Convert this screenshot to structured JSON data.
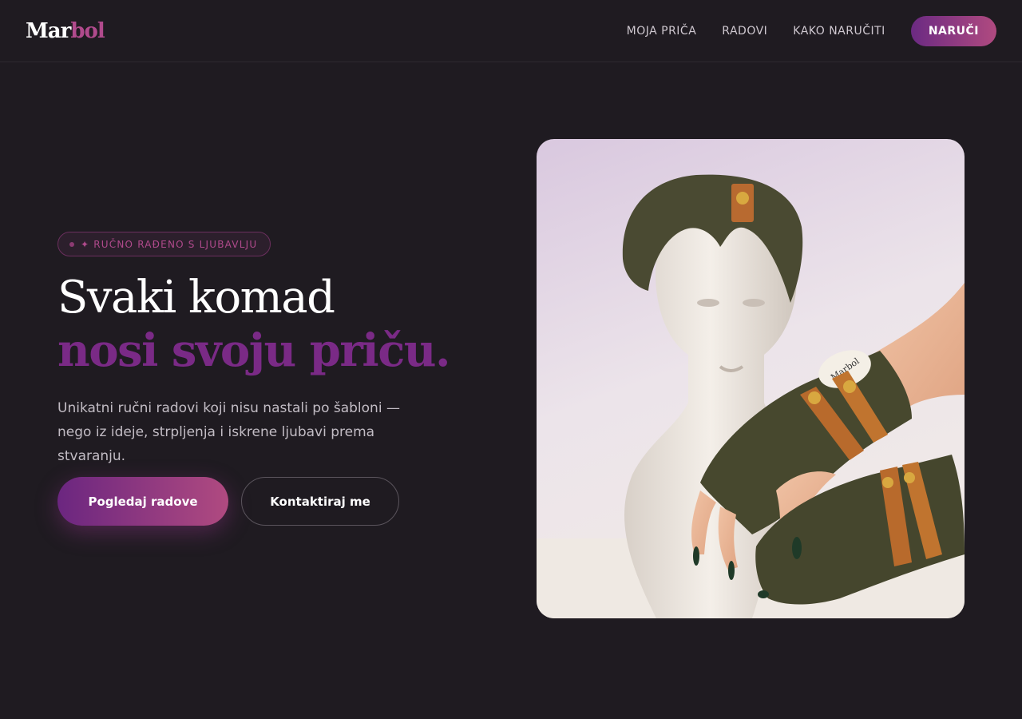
{
  "header": {
    "logo_part1": "Mar",
    "logo_part2": "bol",
    "nav": [
      "MOJA PRIČA",
      "RADOVI",
      "KAKO NARUČITI"
    ],
    "cta": "NARUČI"
  },
  "hero": {
    "badge": "✦ RUČNO RAĐENO S LJUBAVLJU",
    "title_line1": "Svaki komad",
    "title_line2": "nosi svoju priču.",
    "lead": "Unikatni ručni radovi koji nisu nastali po šabloni — nego iz ideje, strpljenja i iskrene ljubavi prema stvaranju.",
    "primary_button": "Pogledaj radove",
    "secondary_button": "Kontaktiraj me",
    "image_label": "Marbol"
  },
  "colors": {
    "background": "#1f1b21",
    "accent": "#7a2a86",
    "accent_pink": "#b04a8c"
  }
}
